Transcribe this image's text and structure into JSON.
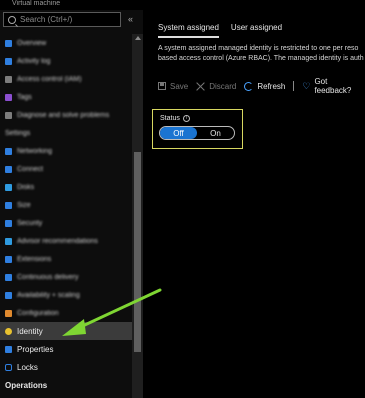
{
  "header": {
    "subtitle": "Virtual machine"
  },
  "search": {
    "placeholder": "Search (Ctrl+/)"
  },
  "sidebar": {
    "collapse_glyph": "«",
    "items": [
      {
        "label": "Overview",
        "color": "#2f7fe0"
      },
      {
        "label": "Activity log",
        "color": "#2f7fe0"
      },
      {
        "label": "Access control (IAM)",
        "color": "#7d7d7d"
      },
      {
        "label": "Tags",
        "color": "#8b4fcf"
      },
      {
        "label": "Diagnose and solve problems",
        "color": "#7d7d7d"
      }
    ],
    "section_settings": "Settings",
    "settings_items": [
      {
        "label": "Networking",
        "color": "#2f7fe0"
      },
      {
        "label": "Connect",
        "color": "#2f7fe0"
      },
      {
        "label": "Disks",
        "color": "#2f9be0"
      },
      {
        "label": "Size",
        "color": "#2f7fe0"
      },
      {
        "label": "Security",
        "color": "#2f7fe0"
      },
      {
        "label": "Advisor recommendations",
        "color": "#2f9be0"
      },
      {
        "label": "Extensions",
        "color": "#2f7fe0"
      },
      {
        "label": "Continuous delivery",
        "color": "#2f7fe0"
      },
      {
        "label": "Availability + scaling",
        "color": "#2f7fe0"
      },
      {
        "label": "Configuration",
        "color": "#e08a2f"
      }
    ],
    "identity": "Identity",
    "properties": "Properties",
    "locks": "Locks",
    "section_operations": "Operations"
  },
  "main": {
    "tabs": [
      "System assigned",
      "User assigned"
    ],
    "description_line1": "A system assigned managed identity is restricted to one per reso",
    "description_line2": "based access control (Azure RBAC). The managed identity is auth",
    "toolbar": {
      "save": "Save",
      "discard": "Discard",
      "refresh": "Refresh",
      "feedback": "Got feedback?"
    },
    "status": {
      "label": "Status",
      "off": "Off",
      "on": "On",
      "selected": "Off"
    }
  },
  "colors": {
    "accent": "#1a74d1",
    "highlight_box": "#d7d760",
    "arrow": "#7fd633"
  }
}
